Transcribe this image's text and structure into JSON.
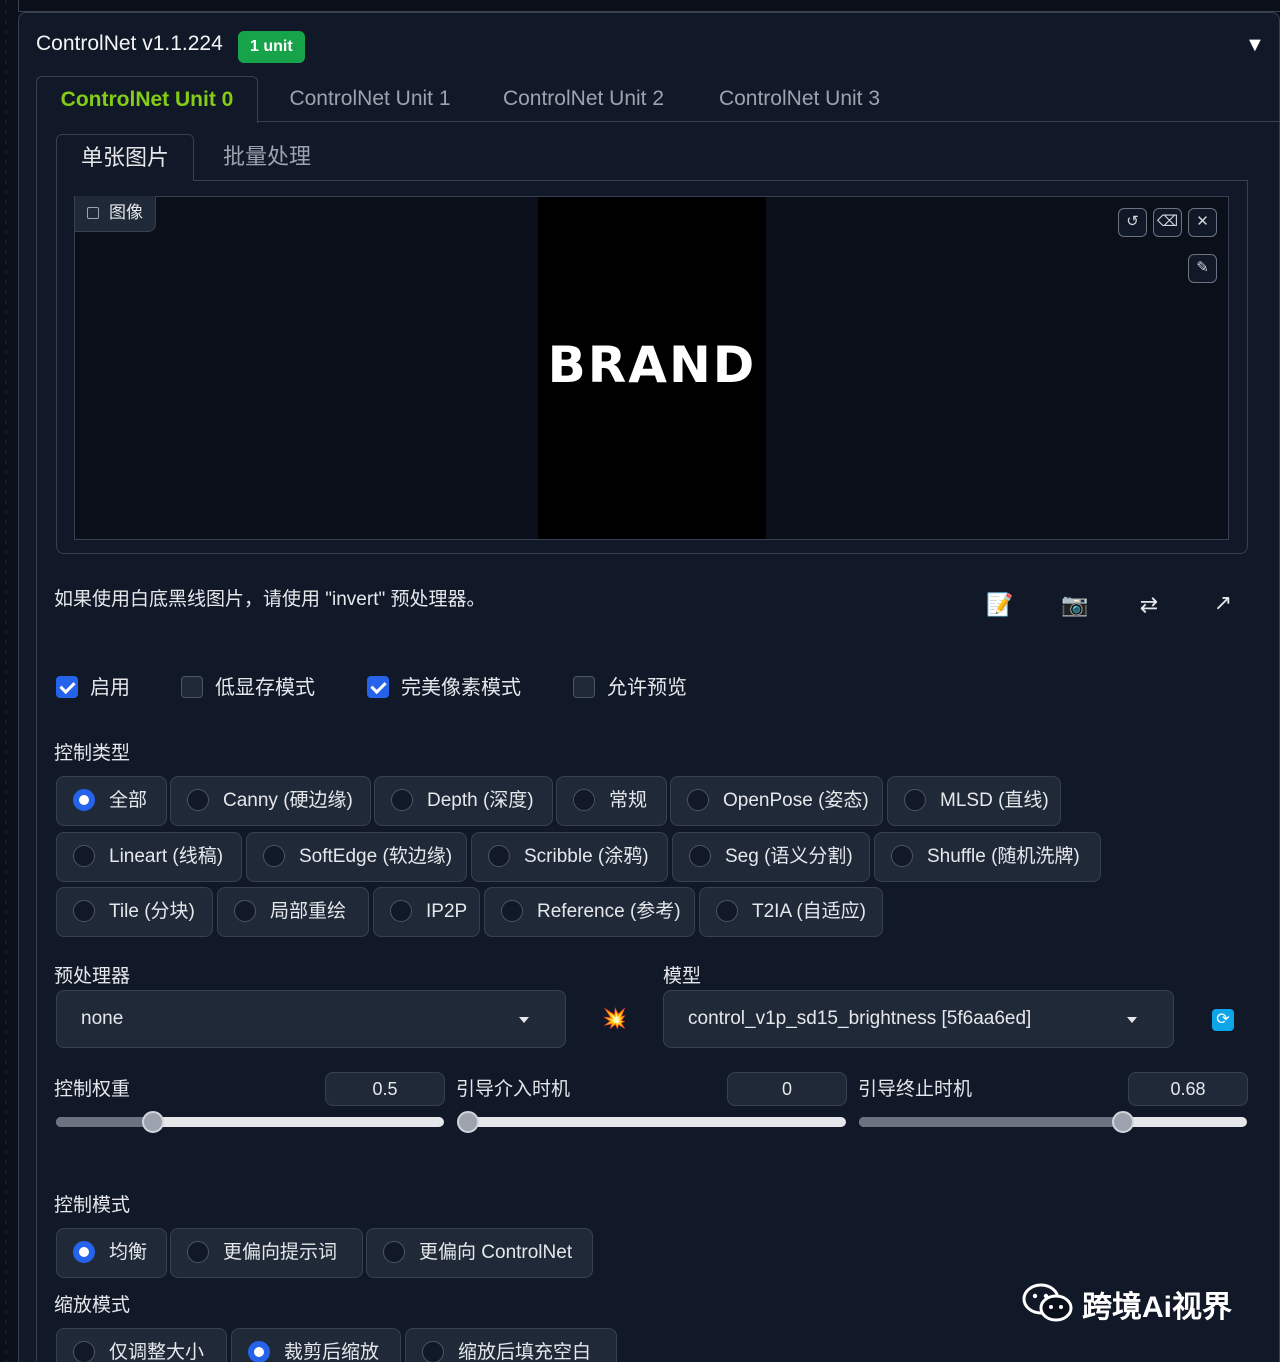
{
  "header": {
    "title": "ControlNet v1.1.224",
    "badge": "1 unit"
  },
  "unit_tabs": [
    "ControlNet Unit 0",
    "ControlNet Unit 1",
    "ControlNet Unit 2",
    "ControlNet Unit 3"
  ],
  "sub_tabs": [
    "单张图片",
    "批量处理"
  ],
  "image": {
    "label": "图像",
    "content_text": "BRAND"
  },
  "hint": "如果使用白底黑线图片，请使用 \"invert\" 预处理器。",
  "checkboxes": [
    {
      "label": "启用",
      "checked": true
    },
    {
      "label": "低显存模式",
      "checked": false
    },
    {
      "label": "完美像素模式",
      "checked": true
    },
    {
      "label": "允许预览",
      "checked": false
    }
  ],
  "control_type": {
    "label": "控制类型",
    "options": [
      "全部",
      "Canny (硬边缘)",
      "Depth (深度)",
      "常规",
      "OpenPose (姿态)",
      "MLSD (直线)",
      "Lineart (线稿)",
      "SoftEdge (软边缘)",
      "Scribble (涂鸦)",
      "Seg (语义分割)",
      "Shuffle (随机洗牌)",
      "Tile (分块)",
      "局部重绘",
      "IP2P",
      "Reference (参考)",
      "T2IA (自适应)"
    ],
    "selected": "全部"
  },
  "preprocessor": {
    "label": "预处理器",
    "value": "none"
  },
  "model": {
    "label": "模型",
    "value": "control_v1p_sd15_brightness [5f6aa6ed]"
  },
  "sliders": [
    {
      "label": "控制权重",
      "value": "0.5",
      "min": 0,
      "max": 2,
      "fraction": 0.25
    },
    {
      "label": "引导介入时机",
      "value": "0",
      "min": 0,
      "max": 1,
      "fraction": 0.0
    },
    {
      "label": "引导终止时机",
      "value": "0.68",
      "min": 0,
      "max": 1,
      "fraction": 0.68
    }
  ],
  "control_mode": {
    "label": "控制模式",
    "options": [
      "均衡",
      "更偏向提示词",
      "更偏向 ControlNet"
    ],
    "selected": "均衡"
  },
  "resize_mode": {
    "label": "缩放模式",
    "options": [
      "仅调整大小",
      "裁剪后缩放",
      "缩放后填充空白"
    ],
    "selected": "裁剪后缩放"
  },
  "watermark": "跨境Ai视界",
  "colors": {
    "accent": "#2563eb",
    "active_tab": "#84cc16",
    "badge": "#16a34a",
    "bg": "#0b0f19"
  }
}
